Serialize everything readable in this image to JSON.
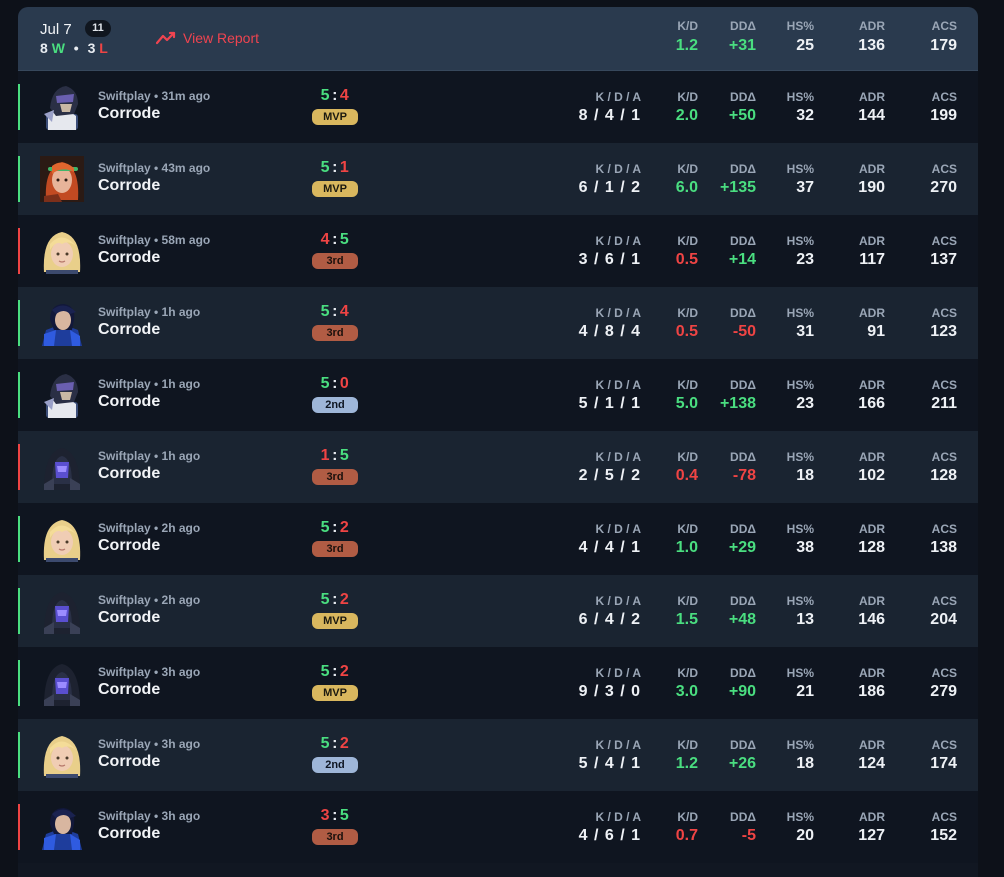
{
  "summary": {
    "date": "Jul 7",
    "match_count": "11",
    "wins": "8",
    "win_letter": "W",
    "separator": "•",
    "losses": "3",
    "loss_letter": "L",
    "view_report_label": "View Report",
    "kd_label": "K/D",
    "kd": "1.2",
    "dd_label": "DDΔ",
    "dd": "+31",
    "hs_label": "HS%",
    "hs": "25",
    "adr_label": "ADR",
    "adr": "136",
    "acs_label": "ACS",
    "acs": "179"
  },
  "labels": {
    "kda": "K / D / A",
    "kd": "K/D",
    "dd": "DDΔ",
    "hs": "HS%",
    "adr": "ADR",
    "acs": "ACS"
  },
  "colors": {
    "win": "#4ade80",
    "loss": "#ef4444",
    "mvp": "#d9b75e",
    "third": "#b15c44",
    "second": "#9eb6d8",
    "accent": "#ef4450"
  },
  "matches": [
    {
      "result": "win",
      "avatar": "dark-armored-agent-icon",
      "meta": "Swiftplay • 31m ago",
      "agent": "Corrode",
      "score_a": "5",
      "score_b": "4",
      "placement": "MVP",
      "kda": "8 / 4 / 1",
      "kd": "2.0",
      "dd": "+50",
      "hs": "32",
      "adr": "144",
      "acs": "199"
    },
    {
      "result": "win",
      "avatar": "red-haired-agent-icon",
      "meta": "Swiftplay • 43m ago",
      "agent": "Corrode",
      "score_a": "5",
      "score_b": "1",
      "placement": "MVP",
      "kda": "6 / 1 / 2",
      "kd": "6.0",
      "dd": "+135",
      "hs": "37",
      "adr": "190",
      "acs": "270"
    },
    {
      "result": "loss",
      "avatar": "blonde-agent-icon",
      "meta": "Swiftplay • 58m ago",
      "agent": "Corrode",
      "score_a": "4",
      "score_b": "5",
      "placement": "3rd",
      "kda": "3 / 6 / 1",
      "kd": "0.5",
      "dd": "+14",
      "hs": "23",
      "adr": "117",
      "acs": "137"
    },
    {
      "result": "win",
      "avatar": "blue-agent-icon",
      "meta": "Swiftplay • 1h ago",
      "agent": "Corrode",
      "score_a": "5",
      "score_b": "4",
      "placement": "3rd",
      "kda": "4 / 8 / 4",
      "kd": "0.5",
      "dd": "-50",
      "hs": "31",
      "adr": "91",
      "acs": "123"
    },
    {
      "result": "win",
      "avatar": "dark-armored-agent-icon",
      "meta": "Swiftplay • 1h ago",
      "agent": "Corrode",
      "score_a": "5",
      "score_b": "0",
      "placement": "2nd",
      "kda": "5 / 1 / 1",
      "kd": "5.0",
      "dd": "+138",
      "hs": "23",
      "adr": "166",
      "acs": "211"
    },
    {
      "result": "loss",
      "avatar": "hooded-agent-icon",
      "meta": "Swiftplay • 1h ago",
      "agent": "Corrode",
      "score_a": "1",
      "score_b": "5",
      "placement": "3rd",
      "kda": "2 / 5 / 2",
      "kd": "0.4",
      "dd": "-78",
      "hs": "18",
      "adr": "102",
      "acs": "128"
    },
    {
      "result": "win",
      "avatar": "blonde-agent-icon",
      "meta": "Swiftplay • 2h ago",
      "agent": "Corrode",
      "score_a": "5",
      "score_b": "2",
      "placement": "3rd",
      "kda": "4 / 4 / 1",
      "kd": "1.0",
      "dd": "+29",
      "hs": "38",
      "adr": "128",
      "acs": "138"
    },
    {
      "result": "win",
      "avatar": "hooded-agent-icon",
      "meta": "Swiftplay • 2h ago",
      "agent": "Corrode",
      "score_a": "5",
      "score_b": "2",
      "placement": "MVP",
      "kda": "6 / 4 / 2",
      "kd": "1.5",
      "dd": "+48",
      "hs": "13",
      "adr": "146",
      "acs": "204"
    },
    {
      "result": "win",
      "avatar": "hooded-agent-icon",
      "meta": "Swiftplay • 3h ago",
      "agent": "Corrode",
      "score_a": "5",
      "score_b": "2",
      "placement": "MVP",
      "kda": "9 / 3 / 0",
      "kd": "3.0",
      "dd": "+90",
      "hs": "21",
      "adr": "186",
      "acs": "279"
    },
    {
      "result": "win",
      "avatar": "blonde-agent-icon",
      "meta": "Swiftplay • 3h ago",
      "agent": "Corrode",
      "score_a": "5",
      "score_b": "2",
      "placement": "2nd",
      "kda": "5 / 4 / 1",
      "kd": "1.2",
      "dd": "+26",
      "hs": "18",
      "adr": "124",
      "acs": "174"
    },
    {
      "result": "loss",
      "avatar": "blue-agent-icon",
      "meta": "Swiftplay • 3h ago",
      "agent": "Corrode",
      "score_a": "3",
      "score_b": "5",
      "placement": "3rd",
      "kda": "4 / 6 / 1",
      "kd": "0.7",
      "dd": "-5",
      "hs": "20",
      "adr": "127",
      "acs": "152"
    }
  ]
}
